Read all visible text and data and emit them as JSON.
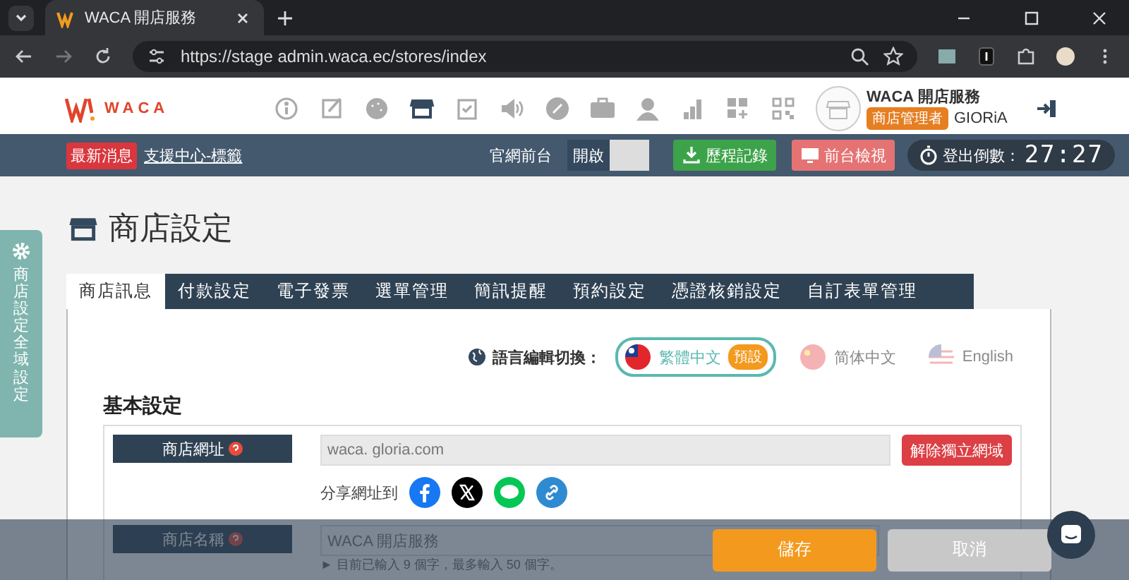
{
  "browser": {
    "tab_title": "WACA 開店服務",
    "url": "https://stage admin.waca.ec/stores/index"
  },
  "header": {
    "logo": "WACA",
    "nav": [
      {
        "kind": "info",
        "selected": false
      },
      {
        "kind": "edit",
        "selected": false
      },
      {
        "kind": "palette",
        "selected": false
      },
      {
        "kind": "store",
        "selected": true
      },
      {
        "kind": "checklist",
        "selected": false
      },
      {
        "kind": "speaker",
        "selected": false
      },
      {
        "kind": "discount",
        "selected": false
      },
      {
        "kind": "briefcase",
        "selected": false
      },
      {
        "kind": "person",
        "selected": false
      },
      {
        "kind": "chart",
        "selected": false
      },
      {
        "kind": "grid-plus",
        "selected": false
      },
      {
        "kind": "qr",
        "selected": false
      }
    ],
    "account": {
      "name": "WACA 開店服務",
      "role": "商店管理者",
      "user": "GIORiA"
    }
  },
  "topbar": {
    "news_badge": "最新消息",
    "news_link": "支援中心-標籤",
    "site_label": "官網前台",
    "site_toggle": "開啟",
    "history_button": "歷程記錄",
    "preview_button": "前台檢視",
    "logout_label": "登出倒數：",
    "countdown": "27:27"
  },
  "side_tab": "商店設定全域設定",
  "page_title": "商店設定",
  "tabs": [
    {
      "label": "商店訊息",
      "selected": true
    },
    {
      "label": "付款設定",
      "selected": false
    },
    {
      "label": "電子發票",
      "selected": false
    },
    {
      "label": "選單管理",
      "selected": false
    },
    {
      "label": "簡訊提醒",
      "selected": false
    },
    {
      "label": "預約設定",
      "selected": false
    },
    {
      "label": "憑證核銷設定",
      "selected": false
    },
    {
      "label": "自訂表單管理",
      "selected": false
    }
  ],
  "language": {
    "label": "語言編輯切換：",
    "options": [
      {
        "kind": "tw",
        "label": "繁體中文",
        "selected": true,
        "badge": "預設"
      },
      {
        "kind": "cn",
        "label": "简体中文",
        "selected": false
      },
      {
        "kind": "us",
        "label": "English",
        "selected": false
      }
    ]
  },
  "section_title": "基本設定",
  "store_url": {
    "label": "商店網址",
    "value": "waca. gloria.com",
    "button": "解除獨立網域",
    "share_label": "分享網址到"
  },
  "store_name": {
    "label": "商店名稱",
    "value": "WACA 開店服務",
    "hint": "► 目前已輸入 9 個字，最多輸入 50 個字。"
  },
  "footer": {
    "save": "儲存",
    "cancel": "取消"
  }
}
